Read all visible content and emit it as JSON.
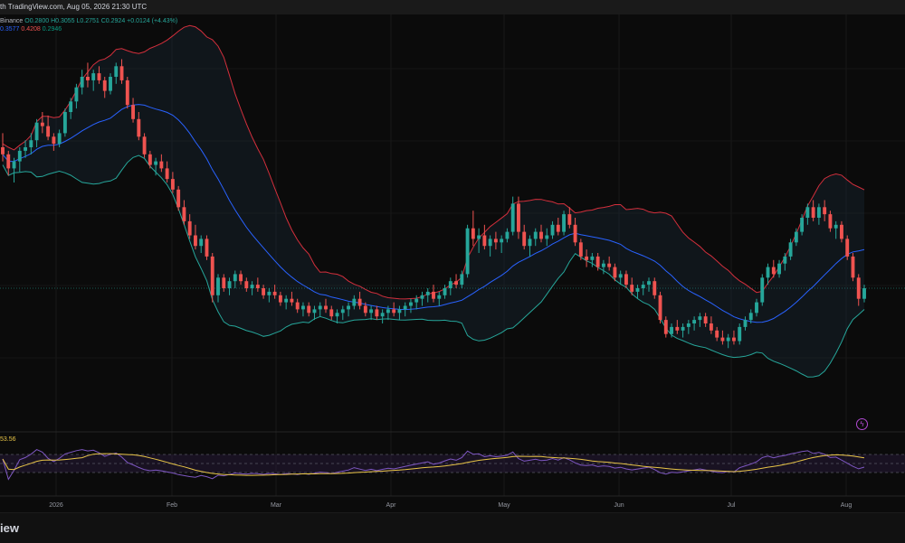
{
  "header": {
    "published": "th TradingView.com, Aug 05, 2026 21:30 UTC"
  },
  "legend": {
    "exchange": "Binance",
    "open": "O0.2800",
    "high": "H0.3055",
    "low": "L0.2751",
    "close": "C0.2924",
    "change": "+0.0124 (+4.43%)",
    "bb_upper": "0.3577",
    "bb_lower": "0.4208",
    "bb_middle": "0.2946",
    "rsi_value": "53.56"
  },
  "footer": {
    "logo_text": "iew"
  },
  "colors": {
    "background": "#0b0b0b",
    "up": "#26a69a",
    "down": "#ef5350",
    "bb_upper": "#d32f3c",
    "bb_lower": "#26a69a",
    "bb_basis": "#2962ff",
    "rsi_line": "#7e57c2",
    "rsi_ma": "#e8c547"
  },
  "icons": {
    "alert": "lightning-bolt-icon"
  },
  "chart_data": [
    {
      "type": "candlestick",
      "note_axis": "price axis not visible; values are relative price levels",
      "x_tick_labels": [
        "2026",
        "Feb",
        "Mar",
        "Apr",
        "May",
        "Jun",
        "Jul",
        "Aug"
      ],
      "price_range": [
        0,
        100
      ],
      "ohlc": [
        [
          70,
          74,
          66,
          68
        ],
        [
          68,
          69,
          62,
          64
        ],
        [
          64,
          67,
          60,
          66
        ],
        [
          66,
          70,
          63,
          69
        ],
        [
          69,
          72,
          67,
          70
        ],
        [
          70,
          74,
          68,
          72
        ],
        [
          72,
          78,
          70,
          77
        ],
        [
          77,
          80,
          74,
          76
        ],
        [
          76,
          79,
          72,
          73
        ],
        [
          73,
          74,
          69,
          71
        ],
        [
          71,
          75,
          70,
          74
        ],
        [
          74,
          81,
          73,
          80
        ],
        [
          80,
          84,
          78,
          83
        ],
        [
          83,
          88,
          81,
          87
        ],
        [
          87,
          92,
          85,
          90
        ],
        [
          90,
          94,
          87,
          89
        ],
        [
          89,
          92,
          86,
          91
        ],
        [
          91,
          93,
          88,
          89
        ],
        [
          89,
          90,
          84,
          86
        ],
        [
          86,
          91,
          85,
          90
        ],
        [
          90,
          94,
          88,
          93
        ],
        [
          93,
          95,
          88,
          89
        ],
        [
          89,
          90,
          81,
          82
        ],
        [
          82,
          84,
          77,
          78
        ],
        [
          78,
          80,
          72,
          73
        ],
        [
          73,
          74,
          67,
          68
        ],
        [
          68,
          69,
          64,
          65
        ],
        [
          65,
          67,
          62,
          66
        ],
        [
          66,
          68,
          63,
          64
        ],
        [
          64,
          66,
          60,
          61
        ],
        [
          61,
          63,
          57,
          58
        ],
        [
          58,
          59,
          52,
          53
        ],
        [
          53,
          55,
          48,
          49
        ],
        [
          49,
          51,
          44,
          45
        ],
        [
          45,
          48,
          41,
          42
        ],
        [
          42,
          45,
          40,
          44
        ],
        [
          44,
          45,
          38,
          39
        ],
        [
          39,
          40,
          26,
          28
        ],
        [
          28,
          34,
          26,
          33
        ],
        [
          33,
          34,
          29,
          30
        ],
        [
          30,
          33,
          28,
          32
        ],
        [
          32,
          35,
          30,
          34
        ],
        [
          34,
          35,
          31,
          32
        ],
        [
          32,
          33,
          29,
          30
        ],
        [
          30,
          32,
          28,
          31
        ],
        [
          31,
          33,
          29,
          30
        ],
        [
          30,
          31,
          27,
          28
        ],
        [
          28,
          30,
          26,
          29
        ],
        [
          29,
          31,
          27,
          28
        ],
        [
          28,
          29,
          25,
          26
        ],
        [
          26,
          28,
          24,
          27
        ],
        [
          27,
          29,
          25,
          26
        ],
        [
          26,
          27,
          23,
          24
        ],
        [
          24,
          26,
          22,
          25
        ],
        [
          25,
          26,
          22,
          23
        ],
        [
          23,
          25,
          21,
          24
        ],
        [
          24,
          26,
          22,
          25
        ],
        [
          25,
          27,
          23,
          24
        ],
        [
          24,
          25,
          21,
          22
        ],
        [
          22,
          24,
          20,
          23
        ],
        [
          23,
          25,
          21,
          24
        ],
        [
          24,
          26,
          22,
          25
        ],
        [
          25,
          28,
          24,
          27
        ],
        [
          27,
          29,
          24,
          25
        ],
        [
          25,
          26,
          22,
          23
        ],
        [
          23,
          25,
          21,
          24
        ],
        [
          24,
          25,
          21,
          22
        ],
        [
          22,
          24,
          20,
          23
        ],
        [
          23,
          25,
          21,
          24
        ],
        [
          24,
          26,
          22,
          23
        ],
        [
          23,
          25,
          21,
          24
        ],
        [
          24,
          26,
          22,
          25
        ],
        [
          25,
          27,
          23,
          26
        ],
        [
          26,
          28,
          24,
          27
        ],
        [
          27,
          29,
          25,
          28
        ],
        [
          28,
          30,
          26,
          29
        ],
        [
          29,
          31,
          26,
          27
        ],
        [
          27,
          29,
          25,
          28
        ],
        [
          28,
          31,
          27,
          30
        ],
        [
          30,
          33,
          28,
          32
        ],
        [
          32,
          34,
          30,
          31
        ],
        [
          31,
          35,
          30,
          34
        ],
        [
          34,
          48,
          33,
          47
        ],
        [
          47,
          52,
          42,
          44
        ],
        [
          44,
          47,
          40,
          45
        ],
        [
          45,
          48,
          41,
          42
        ],
        [
          42,
          45,
          39,
          44
        ],
        [
          44,
          46,
          41,
          43
        ],
        [
          43,
          45,
          40,
          44
        ],
        [
          44,
          47,
          43,
          46
        ],
        [
          46,
          56,
          45,
          54
        ],
        [
          54,
          56,
          44,
          46
        ],
        [
          46,
          48,
          41,
          42
        ],
        [
          42,
          45,
          39,
          44
        ],
        [
          44,
          47,
          42,
          46
        ],
        [
          46,
          48,
          43,
          44
        ],
        [
          44,
          47,
          42,
          45
        ],
        [
          45,
          49,
          44,
          48
        ],
        [
          48,
          50,
          45,
          46
        ],
        [
          46,
          52,
          45,
          51
        ],
        [
          51,
          53,
          47,
          48
        ],
        [
          48,
          50,
          42,
          43
        ],
        [
          43,
          44,
          38,
          39
        ],
        [
          39,
          41,
          36,
          38
        ],
        [
          38,
          40,
          36,
          39
        ],
        [
          39,
          40,
          35,
          36
        ],
        [
          36,
          38,
          34,
          37
        ],
        [
          37,
          39,
          35,
          36
        ],
        [
          36,
          37,
          32,
          33
        ],
        [
          33,
          35,
          31,
          34
        ],
        [
          34,
          35,
          30,
          31
        ],
        [
          31,
          33,
          28,
          29
        ],
        [
          29,
          31,
          27,
          30
        ],
        [
          30,
          32,
          28,
          31
        ],
        [
          31,
          33,
          29,
          32
        ],
        [
          32,
          33,
          27,
          28
        ],
        [
          28,
          29,
          20,
          21
        ],
        [
          21,
          22,
          16,
          17
        ],
        [
          17,
          20,
          16,
          19
        ],
        [
          19,
          21,
          17,
          18
        ],
        [
          18,
          20,
          16,
          19
        ],
        [
          19,
          21,
          17,
          20
        ],
        [
          20,
          22,
          18,
          21
        ],
        [
          21,
          23,
          19,
          22
        ],
        [
          22,
          23,
          19,
          20
        ],
        [
          20,
          22,
          17,
          18
        ],
        [
          18,
          19,
          15,
          16
        ],
        [
          16,
          18,
          14,
          15
        ],
        [
          15,
          17,
          13,
          16
        ],
        [
          16,
          18,
          14,
          15
        ],
        [
          15,
          20,
          14,
          19
        ],
        [
          19,
          22,
          18,
          21
        ],
        [
          21,
          24,
          20,
          23
        ],
        [
          23,
          27,
          22,
          26
        ],
        [
          26,
          34,
          25,
          33
        ],
        [
          33,
          37,
          31,
          36
        ],
        [
          36,
          38,
          33,
          34
        ],
        [
          34,
          38,
          33,
          37
        ],
        [
          37,
          40,
          35,
          39
        ],
        [
          39,
          44,
          38,
          43
        ],
        [
          43,
          47,
          42,
          46
        ],
        [
          46,
          51,
          45,
          50
        ],
        [
          50,
          54,
          48,
          53
        ],
        [
          53,
          55,
          49,
          50
        ],
        [
          50,
          54,
          48,
          53
        ],
        [
          53,
          55,
          49,
          51
        ],
        [
          51,
          52,
          46,
          47
        ],
        [
          47,
          49,
          44,
          48
        ],
        [
          48,
          49,
          43,
          44
        ],
        [
          44,
          45,
          38,
          39
        ],
        [
          39,
          40,
          32,
          33
        ],
        [
          33,
          34,
          25,
          27
        ],
        [
          27,
          31,
          26,
          30
        ]
      ],
      "rsi": {
        "levels": [
          70,
          50,
          30
        ],
        "value": 53.56
      }
    }
  ]
}
